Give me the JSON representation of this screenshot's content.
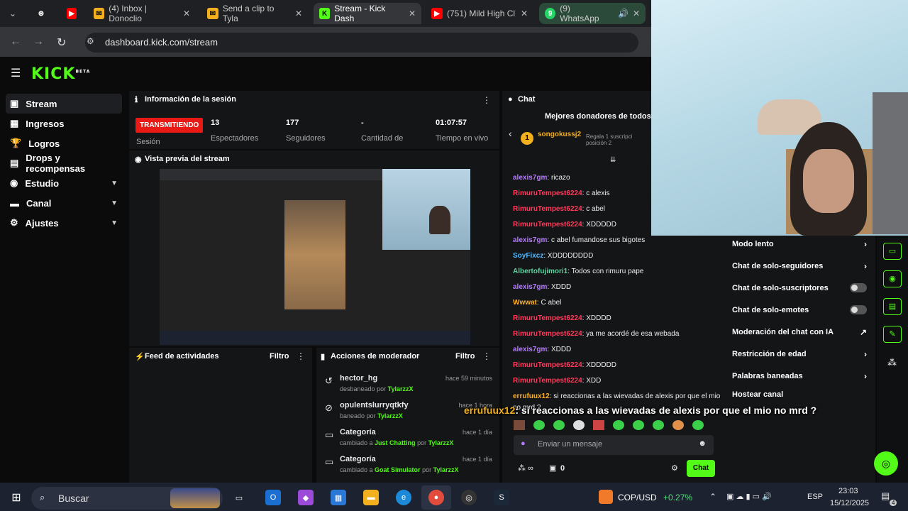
{
  "browser": {
    "tabs": [
      {
        "label": "",
        "icon": "chatgpt-icon"
      },
      {
        "label": "",
        "icon": "youtube-icon"
      },
      {
        "label": "(4) Inbox | Donoclio",
        "icon": "gmail-icon"
      },
      {
        "label": "Send a clip to Tyla",
        "icon": "gmail-icon"
      },
      {
        "label": "Stream - Kick Dash",
        "icon": "kick-icon"
      },
      {
        "label": "(751) Mild High Cl",
        "icon": "youtube-icon"
      },
      {
        "label": "(9) WhatsApp",
        "icon": "whatsapp-icon"
      }
    ],
    "url": "dashboard.kick.com/stream"
  },
  "kick": {
    "logo": "KICK",
    "logo_beta": "BETA"
  },
  "sidebar": {
    "items": [
      {
        "label": "Stream"
      },
      {
        "label": "Ingresos"
      },
      {
        "label": "Logros"
      },
      {
        "label": "Drops y recompensas"
      },
      {
        "label": "Estudio"
      },
      {
        "label": "Canal"
      },
      {
        "label": "Ajustes"
      }
    ]
  },
  "session": {
    "title": "Información de la sesión",
    "status": "TRANSMITIENDO",
    "status_label": "Sesión",
    "stats": [
      {
        "value": "13",
        "label": "Espectadores"
      },
      {
        "value": "177",
        "label": "Seguidores"
      },
      {
        "value": "-",
        "label": "Cantidad de"
      },
      {
        "value": "01:07:57",
        "label": "Tiempo en vivo"
      }
    ]
  },
  "preview": {
    "title": "Vista previa del stream"
  },
  "feed": {
    "title": "Feed de actividades",
    "filter": "Filtro"
  },
  "modactions": {
    "title": "Acciones de moderador",
    "filter": "Filtro",
    "items": [
      {
        "name": "hector_hg",
        "action": "desbaneado",
        "by_word": "por",
        "by": "TylarzzX",
        "time": "hace 59 minutos"
      },
      {
        "name": "opulentslurryqtkfy",
        "action": "baneado",
        "by_word": "por",
        "by": "TylarzzX",
        "time": "hace 1 hora"
      },
      {
        "name": "Categoría",
        "action": "cambiado a",
        "target": "Just Chatting",
        "by_word": "por",
        "by": "TylarzzX",
        "time": "hace 1 día"
      },
      {
        "name": "Categoría",
        "action": "cambiado a",
        "target": "Goat Simulator",
        "by_word": "por",
        "by": "TylarzzX",
        "time": "hace 1 día"
      }
    ]
  },
  "chat": {
    "title": "Chat",
    "top_donors": "Mejores donadores de todos los",
    "donor_name": "songokussj2",
    "donor_rank": "1",
    "donor_note": "Regala 1 suscripci",
    "donor_note2": "posición 2",
    "messages": [
      {
        "user": "alexis7gm",
        "text": "ricazo",
        "color": "#b57bff"
      },
      {
        "user": "RimuruTempest6224",
        "text": "c alexis",
        "color": "#ff3b5c"
      },
      {
        "user": "RimuruTempest6224",
        "text": "c abel",
        "color": "#ff3b5c"
      },
      {
        "user": "RimuruTempest6224",
        "text": "XDDDDD",
        "color": "#ff3b5c"
      },
      {
        "user": "alexis7gm",
        "text": "c abel fumandose sus bigotes",
        "color": "#b57bff"
      },
      {
        "user": "SoyFixcz",
        "text": "XDDDDDDDD",
        "color": "#53b9ff"
      },
      {
        "user": "Albertofujimori1",
        "text": "Todos con rimuru pape",
        "color": "#5dd39e"
      },
      {
        "user": "alexis7gm",
        "text": "XDDD",
        "color": "#b57bff"
      },
      {
        "user": "Wwwat",
        "text": "C abel",
        "color": "#ffb020"
      },
      {
        "user": "RimuruTempest6224",
        "text": "XDDDD",
        "color": "#ff3b5c"
      },
      {
        "user": "RimuruTempest6224",
        "text": "ya me acordé de esa webada",
        "color": "#ff3b5c"
      },
      {
        "user": "alexis7gm",
        "text": "XDDD",
        "color": "#b57bff"
      },
      {
        "user": "RimuruTempest6224",
        "text": "XDDDDD",
        "color": "#ff3b5c"
      },
      {
        "user": "RimuruTempest6224",
        "text": "XDD",
        "color": "#ff3b5c"
      },
      {
        "user": "errufuux12",
        "text": "si reaccionas a las wievadas de alexis por que el mio",
        "color": "#ffb020"
      }
    ],
    "msg_cont": "no mrd ?",
    "input_placeholder": "Enviar un mensaje",
    "points": "0",
    "send_label": "Chat"
  },
  "menu": {
    "items": [
      {
        "label": "Modo lento",
        "kind": "arrow"
      },
      {
        "label": "Chat de solo-seguidores",
        "kind": "arrow"
      },
      {
        "label": "Chat de solo-suscriptores",
        "kind": "toggle"
      },
      {
        "label": "Chat de solo-emotes",
        "kind": "toggle"
      },
      {
        "label": "Moderación del chat con IA",
        "kind": "link"
      },
      {
        "label": "Restricción de edad",
        "kind": "arrow"
      },
      {
        "label": "Palabras baneadas",
        "kind": "arrow"
      },
      {
        "label": "Hostear canal",
        "kind": "none"
      }
    ]
  },
  "overlay": {
    "user": "errufuux12",
    "text": ": si reaccionas a las wievadas de alexis por que el mio no mrd ?"
  },
  "taskbar": {
    "search": "Buscar",
    "ticker": "COP/USD",
    "ticker_change": "+0.27%",
    "lang": "ESP",
    "time": "23:03",
    "date": "15/12/2025",
    "notif_count": "4"
  },
  "colors": {
    "accent": "#53fc18",
    "live": "#e91916"
  }
}
